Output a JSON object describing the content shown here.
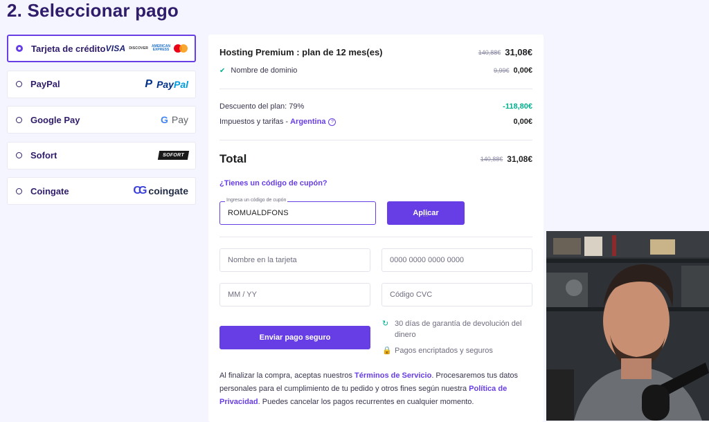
{
  "page_title": "2. Seleccionar pago",
  "methods": [
    {
      "label": "Tarjeta de crédito",
      "selected": true,
      "logos": [
        "VISA",
        "DISCOVER",
        "AMERICAN EXPRESS",
        "mastercard"
      ]
    },
    {
      "label": "PayPal",
      "logo_text_1": "Pay",
      "logo_text_2": "Pal"
    },
    {
      "label": "Google Pay",
      "logo_g": "G",
      "logo_text": "Pay"
    },
    {
      "label": "Sofort",
      "logo_text": "SOFORT"
    },
    {
      "label": "Coingate",
      "logo_text": "coingate"
    }
  ],
  "summary": {
    "plan_label": "Hosting Premium : plan de 12 mes(es)",
    "plan_old": "140,88€",
    "plan_price": "31,08€",
    "domain_label": "Nombre de dominio",
    "domain_old": "9,99€",
    "domain_price": "0,00€",
    "discount_label": "Descuento del plan: 79%",
    "discount_value": "-118,80€",
    "tax_label": "Impuestos y tarifas - ",
    "tax_country": "Argentina",
    "tax_help": "?",
    "tax_value": "0,00€",
    "total_label": "Total",
    "total_old": "140,88€",
    "total_price": "31,08€"
  },
  "coupon": {
    "question": "¿Tienes un código de cupón?",
    "field_label": "Ingresa un código de cupón",
    "field_value": "ROMUALDFONS",
    "apply_label": "Aplicar"
  },
  "card_form": {
    "name_placeholder": "Nombre en la tarjeta",
    "number_placeholder": "0000 0000 0000 0000",
    "expiry_placeholder": "MM / YY",
    "cvc_placeholder": "Código CVC",
    "submit_label": "Enviar pago seguro"
  },
  "guarantees": {
    "refund": "30 días de garantía de devolución del dinero",
    "secure": "Pagos encriptados y seguros"
  },
  "legal": {
    "part1": "Al finalizar la compra, aceptas nuestros ",
    "terms": "Términos de Servicio",
    "part2": ". Procesaremos tus datos personales para el cumplimiento de tu pedido y otros fines según nuestra ",
    "privacy": "Política de Privacidad",
    "part3": ". Puedes cancelar los pagos recurrentes en cualquier momento."
  },
  "colors": {
    "accent": "#673de6",
    "dark": "#2f1c6a",
    "success": "#00b090",
    "background": "#f4f5ff"
  }
}
